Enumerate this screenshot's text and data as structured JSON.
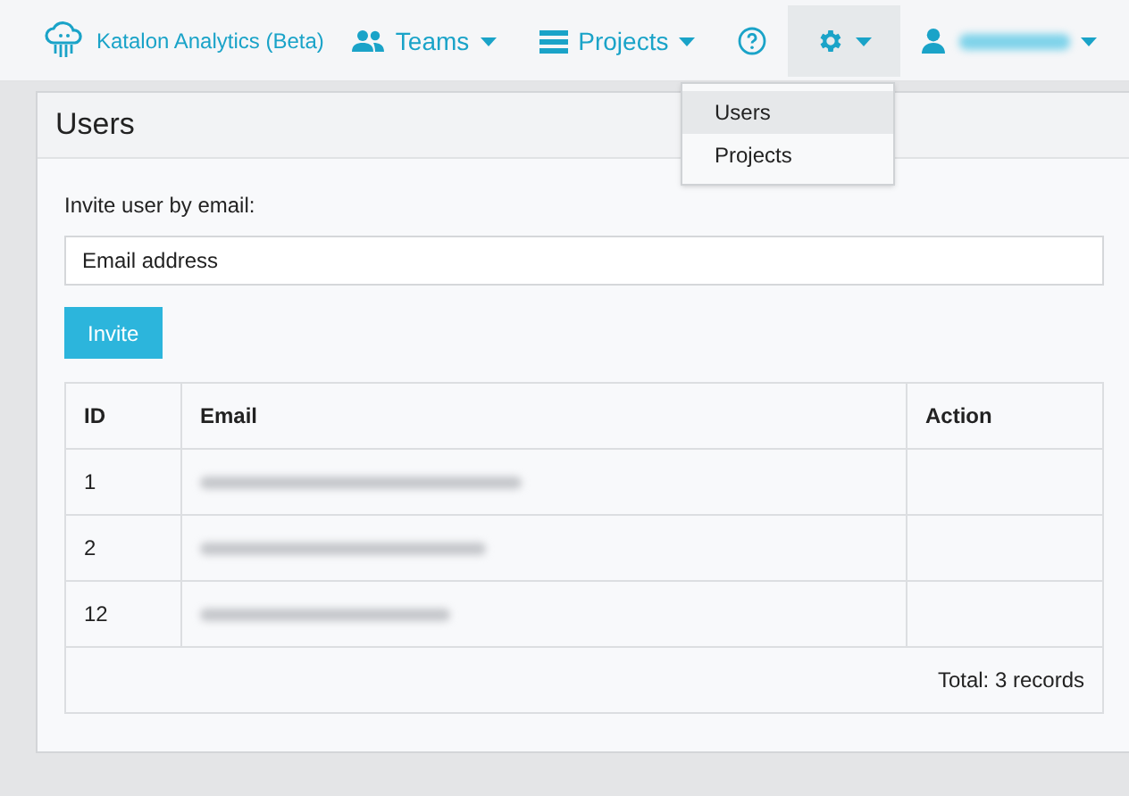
{
  "navbar": {
    "brand": "Katalon Analytics (Beta)",
    "items": [
      {
        "kind": "teams",
        "label": "Teams"
      },
      {
        "kind": "projects",
        "label": "Projects"
      },
      {
        "kind": "help"
      },
      {
        "kind": "settings",
        "active": true
      },
      {
        "kind": "user"
      }
    ]
  },
  "settings_menu": [
    {
      "label": "Users",
      "selected": true
    },
    {
      "label": "Projects",
      "selected": false
    }
  ],
  "panel": {
    "title": "Users",
    "invite_label": "Invite user by email:",
    "email_placeholder": "Email address",
    "invite_button": "Invite"
  },
  "table": {
    "columns": [
      "ID",
      "Email",
      "Action"
    ],
    "rows": [
      {
        "cells": [
          "1"
        ]
      },
      {
        "cells": [
          "2"
        ]
      },
      {
        "cells": [
          "12"
        ]
      }
    ],
    "footer": "Total: 3 records"
  }
}
